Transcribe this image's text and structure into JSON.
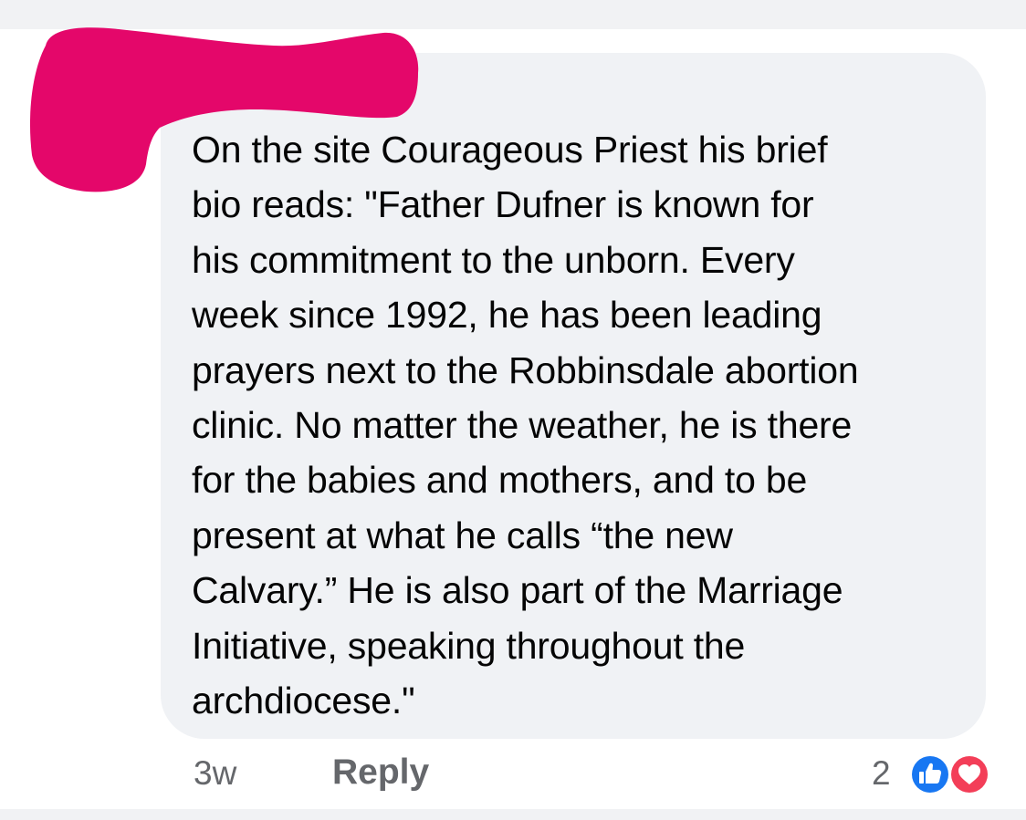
{
  "comment": {
    "lines": [
      "On the site Courageous Priest his brief",
      "bio reads: \"Father Dufner is known for",
      "his commitment to the unborn. Every",
      "week since 1992, he has been leading",
      "prayers next to the Robbinsdale abortion",
      "clinic. No matter the weather, he is there",
      "for the babies and mothers, and to be",
      "present at what he calls “the new",
      "Calvary.” He is also part of the Marriage",
      "Initiative, speaking throughout the",
      "archdiocese.\""
    ]
  },
  "meta": {
    "time": "3w",
    "reply_label": "Reply",
    "reaction_count": "2"
  },
  "reactions": [
    "like-icon",
    "love-icon"
  ],
  "colors": {
    "bubble": "#f0f2f5",
    "redaction": "#e4076a",
    "like": "#1877f2",
    "love": "#f33e58",
    "meta_text": "#65676b"
  }
}
